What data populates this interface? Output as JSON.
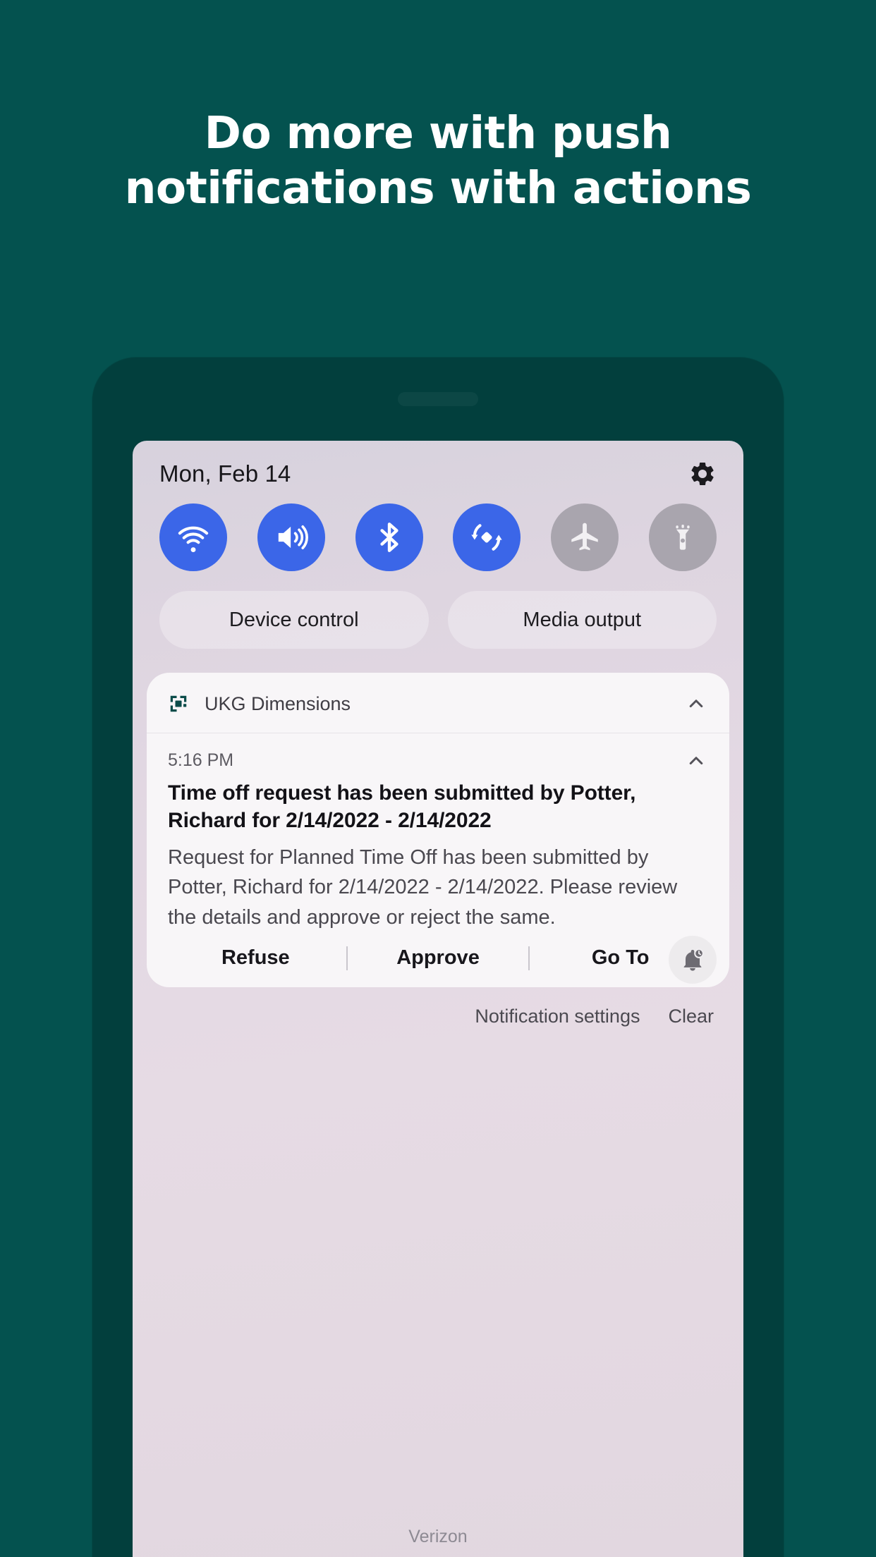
{
  "headline": {
    "line1": "Do more with push",
    "line2": "notifications with actions"
  },
  "colors": {
    "background": "#04524f",
    "phone_bezel": "#023f3d",
    "toggle_on": "#3b66e8",
    "toggle_off": "#a9a5ae",
    "card": "#f8f6f8",
    "app_icon": "#0b4c4a"
  },
  "quick_settings": {
    "date": "Mon, Feb 14",
    "settings_icon": "gear-icon",
    "toggles": [
      {
        "name": "wifi-toggle",
        "icon": "wifi-icon",
        "state": "on"
      },
      {
        "name": "sound-toggle",
        "icon": "sound-icon",
        "state": "on"
      },
      {
        "name": "bluetooth-toggle",
        "icon": "bluetooth-icon",
        "state": "on"
      },
      {
        "name": "auto-rotate-toggle",
        "icon": "auto-rotate-icon",
        "state": "on"
      },
      {
        "name": "airplane-toggle",
        "icon": "airplane-icon",
        "state": "off"
      },
      {
        "name": "flashlight-toggle",
        "icon": "flashlight-icon",
        "state": "off"
      }
    ],
    "pills": [
      {
        "label": "Device control"
      },
      {
        "label": "Media output"
      }
    ]
  },
  "notification": {
    "app_name": "UKG Dimensions",
    "app_icon": "ukg-dimensions-icon",
    "collapse_icon": "chevron-up-icon",
    "time": "5:16 PM",
    "title": "Time off request has been submitted by Potter, Richard for 2/14/2022 - 2/14/2022",
    "body": "Request for Planned Time Off has been submitted by Potter, Richard for 2/14/2022 - 2/14/2022. Please review the details and approve or reject the same.",
    "actions": [
      {
        "label": "Refuse"
      },
      {
        "label": "Approve"
      },
      {
        "label": "Go To"
      }
    ],
    "snooze_icon": "bell-clock-icon"
  },
  "shade_footer": {
    "notification_settings": "Notification settings",
    "clear": "Clear"
  },
  "status_bar": {
    "carrier": "Verizon"
  }
}
